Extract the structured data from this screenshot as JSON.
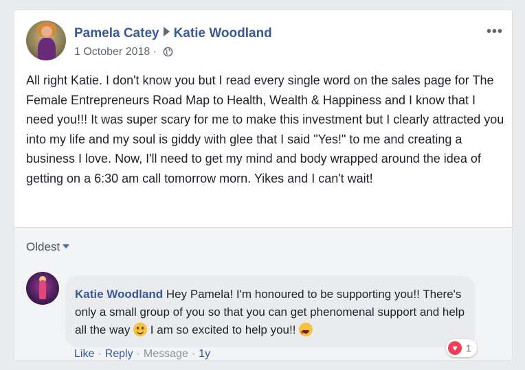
{
  "post": {
    "author": "Pamela Catey",
    "target": "Katie Woodland",
    "date": "1 October 2018",
    "dot": "·",
    "more": "•••",
    "text": "All right Katie. I don't know you but I read every single word on the sales page for The Female Entrepreneurs Road Map to Health, Wealth & Happiness and I know that I need you!!! It was super scary for me to make this investment but I clearly attracted you into my life and my soul is giddy with glee that I said \"Yes!\" to me and creating a business I love. Now, I'll need to get my mind and body wrapped around the idea of getting on a 6:30 am call tomorrow morn. Yikes and I can't wait!"
  },
  "comments": {
    "sort_label": "Oldest",
    "items": [
      {
        "author": "Katie Woodland",
        "text_part1": " Hey Pamela! I'm honoured to be supporting you!! There's only a small group of you so that you can get phenomenal support and help all the way ",
        "text_part2": " I am so excited to help you!! ",
        "reaction_count": "1",
        "like_label": "Like",
        "reply_label": "Reply",
        "message_label": "Message",
        "time": "1y",
        "dot": "·"
      }
    ]
  },
  "icons": [
    "globe-icon",
    "more-icon",
    "caret-down-icon",
    "smile-emoji",
    "heart-eyes-emoji",
    "love-reaction-icon"
  ],
  "colors": {
    "link": "#385898",
    "love": "#f33e58"
  }
}
